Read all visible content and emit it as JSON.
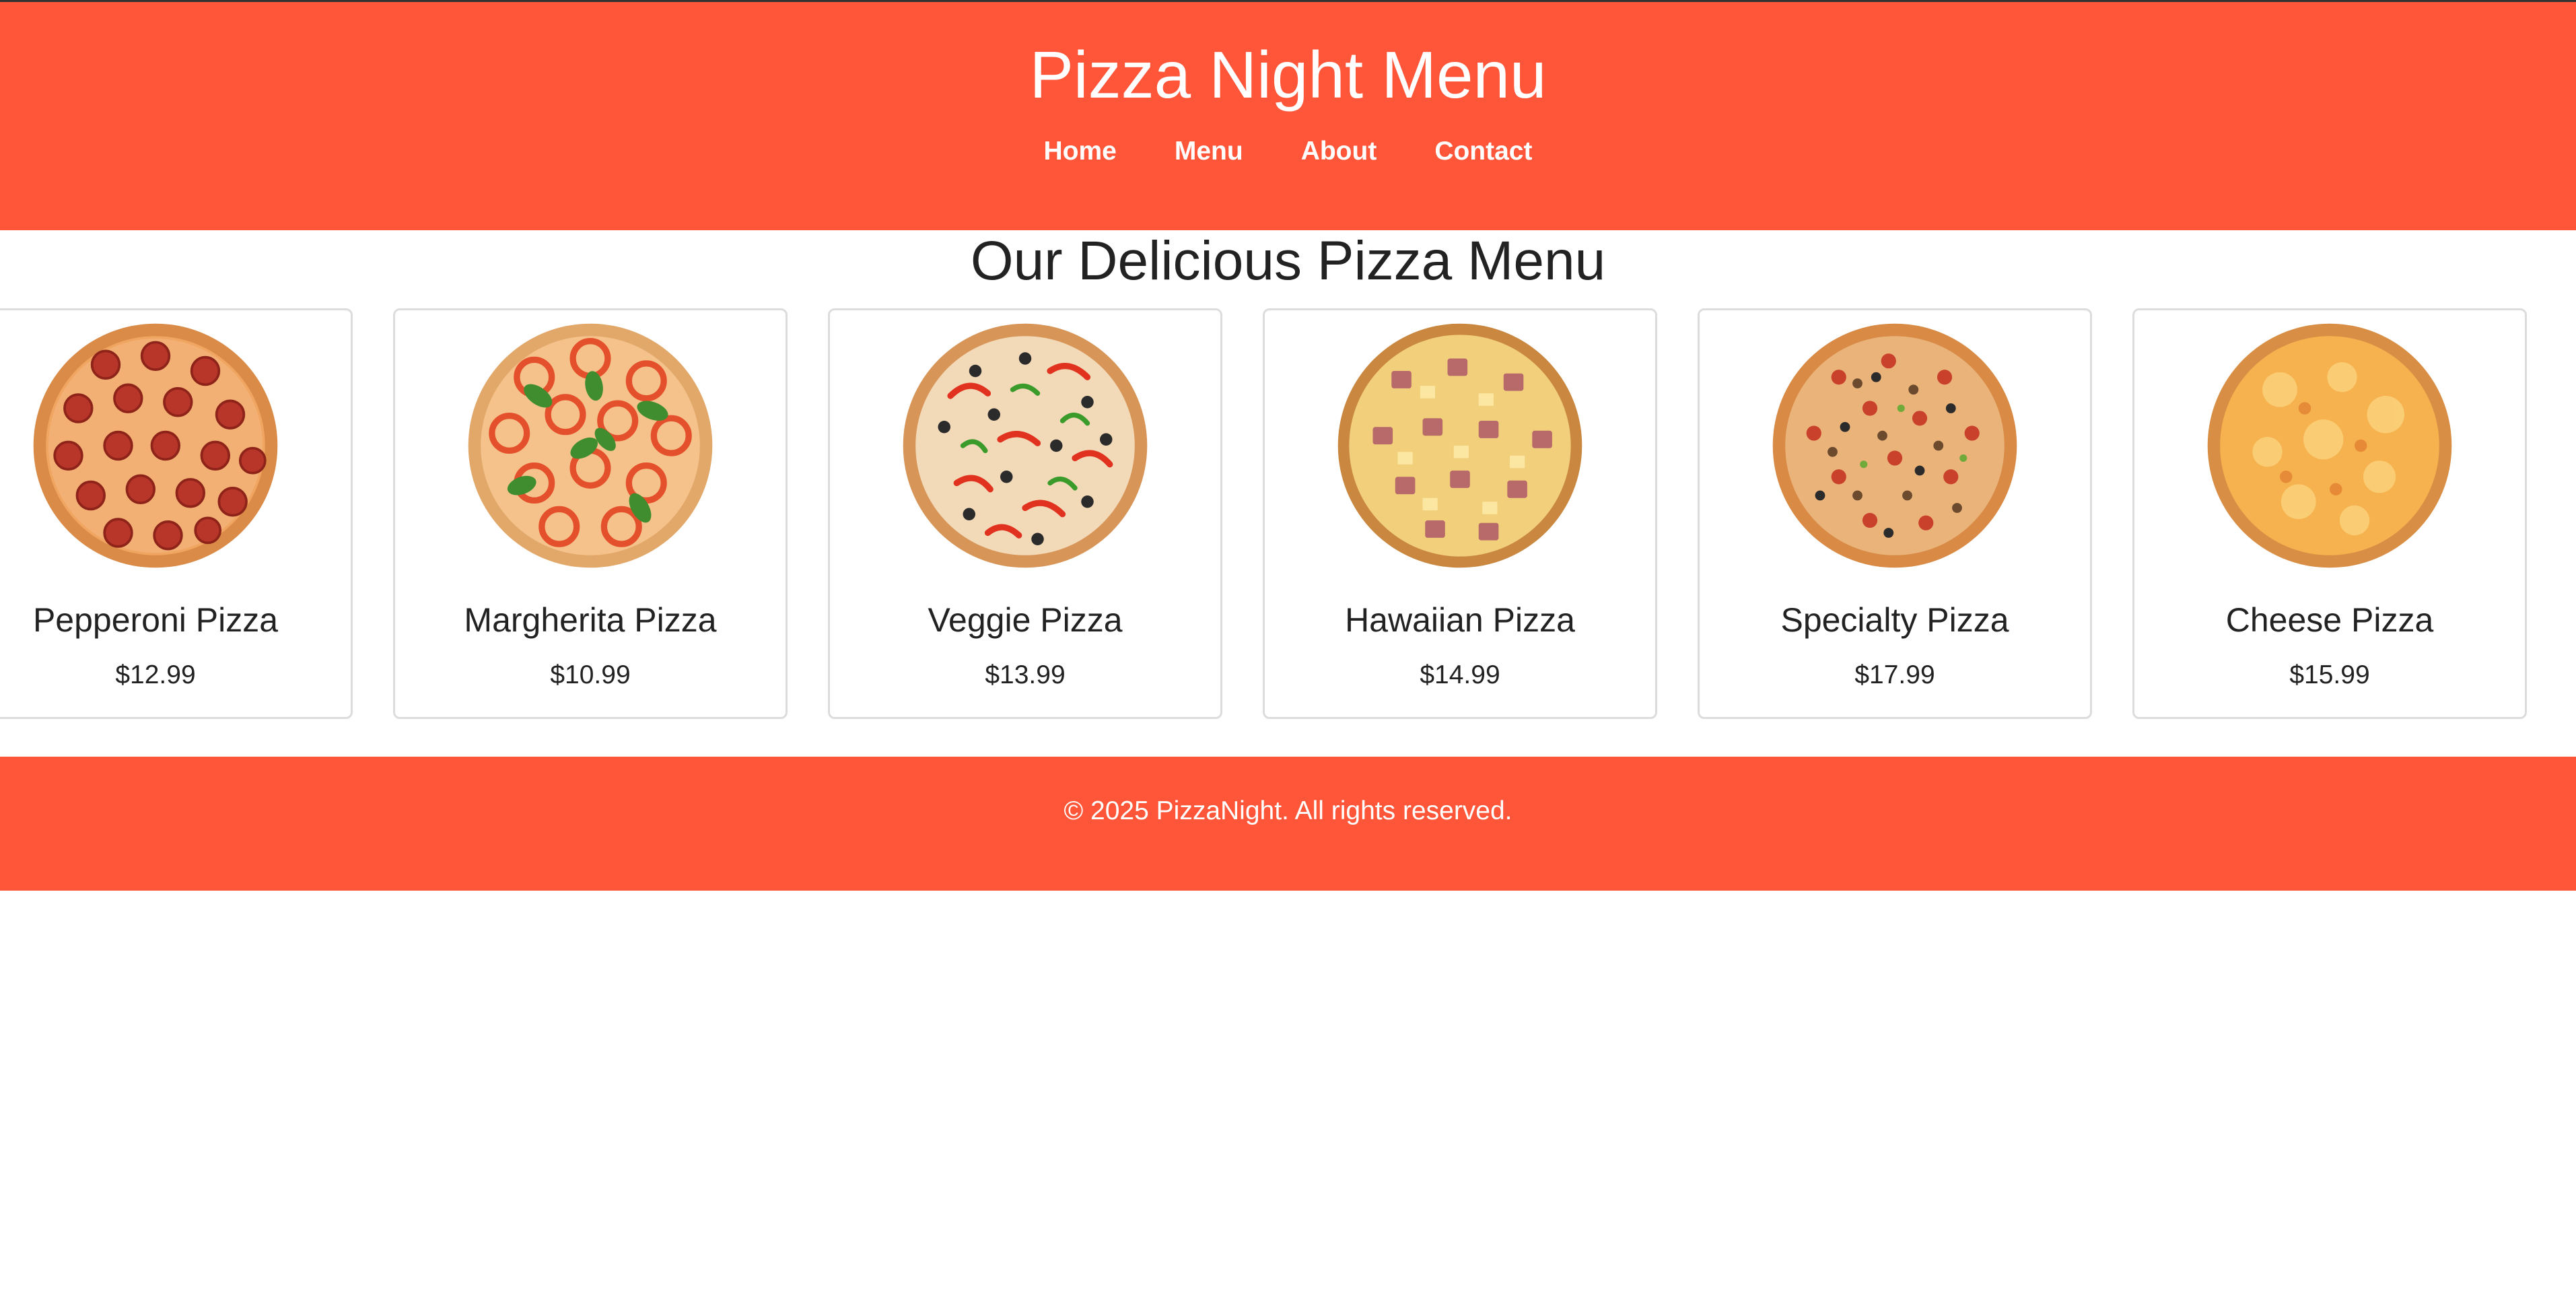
{
  "header": {
    "title": "Pizza Night Menu",
    "nav": [
      "Home",
      "Menu",
      "About",
      "Contact"
    ]
  },
  "main": {
    "section_title": "Our Delicious Pizza Menu",
    "cards": [
      {
        "name": "Pepperoni Pizza",
        "price": "$12.99",
        "image": "pepperoni-pizza-image"
      },
      {
        "name": "Margherita Pizza",
        "price": "$10.99",
        "image": "margherita-pizza-image"
      },
      {
        "name": "Veggie Pizza",
        "price": "$13.99",
        "image": "veggie-pizza-image"
      },
      {
        "name": "Hawaiian Pizza",
        "price": "$14.99",
        "image": "hawaiian-pizza-image"
      },
      {
        "name": "Specialty Pizza",
        "price": "$17.99",
        "image": "specialty-pizza-image"
      },
      {
        "name": "Cheese Pizza",
        "price": "$15.99",
        "image": "cheese-pizza-image"
      }
    ]
  },
  "footer": {
    "text": "© 2025 PizzaNight. All rights reserved."
  },
  "colors": {
    "brand": "#ff5639",
    "text": "#222222",
    "card_border": "#dcdcdc",
    "header_text": "#ffffff"
  }
}
